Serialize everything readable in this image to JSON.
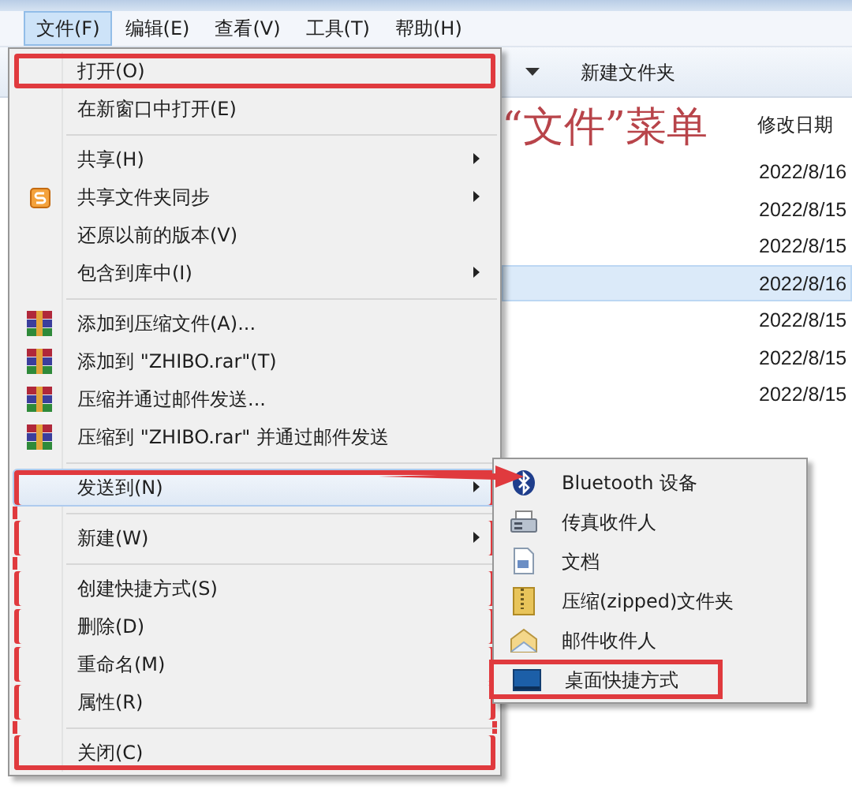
{
  "menubar": [
    {
      "label": "文件(F)",
      "selected": true
    },
    {
      "label": "编辑(E)",
      "selected": false
    },
    {
      "label": "查看(V)",
      "selected": false
    },
    {
      "label": "工具(T)",
      "selected": false
    },
    {
      "label": "帮助(H)",
      "selected": false
    }
  ],
  "explorer": {
    "toolbar_button": "新建文件夹",
    "column_header": "修改日期",
    "rows": [
      {
        "date": "2022/8/16",
        "selected": false
      },
      {
        "date": "2022/8/15",
        "selected": false
      },
      {
        "date": "2022/8/15",
        "selected": false
      },
      {
        "date": "2022/8/16",
        "selected": true
      },
      {
        "date": "2022/8/15",
        "selected": false
      },
      {
        "date": "2022/8/15",
        "selected": false
      },
      {
        "date": "2022/8/15",
        "selected": false
      }
    ]
  },
  "annotation": "“文件”菜单",
  "file_menu": [
    {
      "kind": "plain",
      "label": "打开(O)",
      "framed": true
    },
    {
      "kind": "plain",
      "label": "在新窗口中打开(E)"
    },
    {
      "kind": "separator"
    },
    {
      "kind": "plain",
      "label": "共享(H)",
      "submenu": true
    },
    {
      "kind": "sync",
      "label": "共享文件夹同步",
      "submenu": true
    },
    {
      "kind": "plain",
      "label": "还原以前的版本(V)"
    },
    {
      "kind": "plain",
      "label": "包含到库中(I)",
      "submenu": true
    },
    {
      "kind": "separator"
    },
    {
      "kind": "archive",
      "label": "添加到压缩文件(A)..."
    },
    {
      "kind": "archive",
      "label": "添加到 \"ZHIBO.rar\"(T)"
    },
    {
      "kind": "archive",
      "label": "压缩并通过邮件发送..."
    },
    {
      "kind": "archive",
      "label": "压缩到 \"ZHIBO.rar\" 并通过邮件发送"
    },
    {
      "kind": "separator"
    },
    {
      "kind": "plain",
      "label": "发送到(N)",
      "submenu": true,
      "selected": true,
      "framed": true
    },
    {
      "kind": "separator"
    },
    {
      "kind": "plain",
      "label": "新建(W)",
      "submenu": true,
      "framed": true
    },
    {
      "kind": "separator"
    },
    {
      "kind": "plain",
      "label": "创建快捷方式(S)",
      "framed": true
    },
    {
      "kind": "plain",
      "label": "删除(D)",
      "framed": true
    },
    {
      "kind": "plain",
      "label": "重命名(M)",
      "framed": true
    },
    {
      "kind": "plain",
      "label": "属性(R)",
      "framed": true
    },
    {
      "kind": "separator"
    },
    {
      "kind": "plain",
      "label": "关闭(C)",
      "framed": true
    }
  ],
  "send_to_menu": [
    {
      "label": "Bluetooth 设备",
      "kind": "bluetooth"
    },
    {
      "label": "传真收件人",
      "kind": "fax"
    },
    {
      "label": "文档",
      "kind": "document"
    },
    {
      "label": "压缩(zipped)文件夹",
      "kind": "zip"
    },
    {
      "label": "邮件收件人",
      "kind": "mail"
    },
    {
      "label": "桌面快捷方式",
      "kind": "desktop",
      "framed": true
    }
  ]
}
